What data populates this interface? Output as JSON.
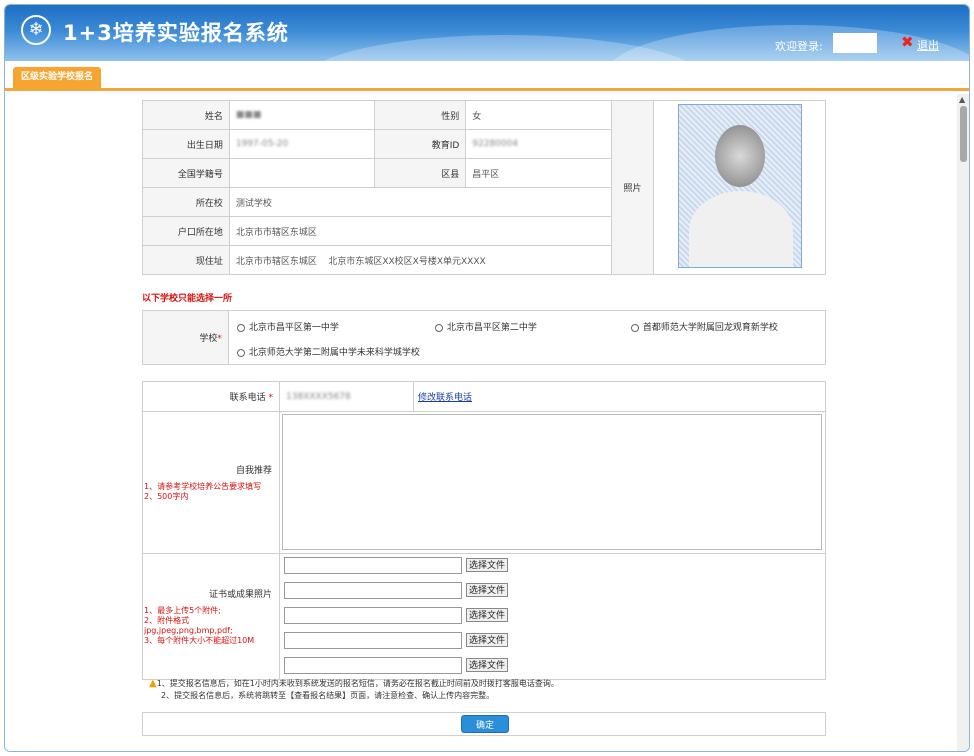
{
  "header": {
    "title": "1+3培养实验报名系统",
    "logo_glyph": "❄",
    "welcome_label": "欢迎登录:",
    "logout_label": "退出",
    "logout_icon": "✖"
  },
  "tabs": [
    {
      "label": "区级实验学校报名"
    }
  ],
  "student": {
    "name_label": "姓名",
    "name_value": "■■■",
    "gender_label": "性别",
    "gender_value": "女",
    "birth_label": "出生日期",
    "birth_value": "1997-05-20",
    "eduid_label": "教育ID",
    "eduid_value": "92280004",
    "national_id_label": "全国学籍号",
    "national_id_value": "",
    "district_label": "区县",
    "district_value": "昌平区",
    "school_label": "所在校",
    "school_value": "测试学校",
    "hukou_label": "户口所在地",
    "hukou_value": "北京市市辖区东城区",
    "address_label": "现住址",
    "address_value": "北京市市辖区东城区    北京市东城区XX校区X号楼X单元XXXX",
    "photo_label": "照片"
  },
  "school_select": {
    "warning": "以下学校只能选择一所",
    "label": "学校",
    "required_mark": "*",
    "options": [
      "北京市昌平区第一中学",
      "北京市昌平区第二中学",
      "首都师范大学附属回龙观育新学校",
      "北京师范大学第二附属中学未来科学城学校"
    ]
  },
  "contact": {
    "phone_label": "联系电话",
    "required_mark": "*",
    "phone_value": "138XXXX5678",
    "edit_link": "修改联系电话"
  },
  "intro": {
    "label": "自我推荐",
    "hint1": "1、请参考学校培养公告要求填写",
    "hint2": "2、500字内"
  },
  "certificates": {
    "label": "证书或成果照片",
    "hint1": "1、最多上传5个附件;",
    "hint2": "2、附件格式",
    "hint3": "jpg,jpeg,png,bmp,pdf;",
    "hint4": "3、每个附件大小不能超过10M",
    "button_label": "选择文件",
    "rows": 5
  },
  "notes": {
    "note1": "1、提交报名信息后，如在1小时内未收到系统发送的报名短信，请务必在报名截止时间前及时拨打客服电话查询。",
    "note2": "2、提交报名信息后，系统将跳转至【查看报名结果】页面，请注意检查、确认上传内容完整。"
  },
  "submit_label": "确定",
  "colors": {
    "header_blue": "#1d6fc4",
    "tab_orange": "#f6a532",
    "required_red": "#d6130f",
    "button_blue": "#2a8ed8"
  }
}
